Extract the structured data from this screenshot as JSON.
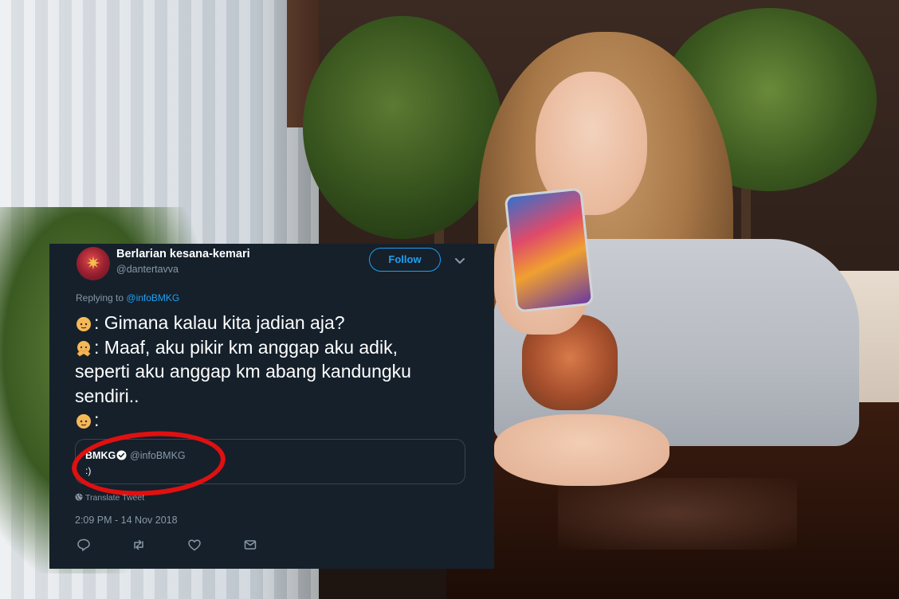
{
  "tweet": {
    "display_name": "Berlarian kesana-kemari",
    "handle": "@dantertavva",
    "follow_label": "Follow",
    "replying_prefix": "Replying to",
    "replying_to": "@infoBMKG",
    "lines": [
      ": Gimana kalau kita jadian aja?",
      ": Maaf, aku pikir km anggap aku adik,",
      "seperti aku anggap km abang kandungku",
      "sendiri..",
      ":"
    ],
    "quoted": {
      "name": "BMKG",
      "handle": "@infoBMKG",
      "text": ":)"
    },
    "translate_label": "Translate Tweet",
    "timestamp": "2:09 PM - 14 Nov 2018"
  },
  "icons": {
    "emoji_1": "man-emoji",
    "emoji_2": "woman-gesture-emoji",
    "emoji_3": "man-emoji",
    "verified": "verified-badge-icon",
    "actions": [
      "reply-icon",
      "retweet-icon",
      "like-icon",
      "dm-icon"
    ]
  },
  "colors": {
    "card_bg": "#15202b",
    "accent": "#1da1f2",
    "muted": "#8899a6",
    "highlight": "#e01010"
  }
}
